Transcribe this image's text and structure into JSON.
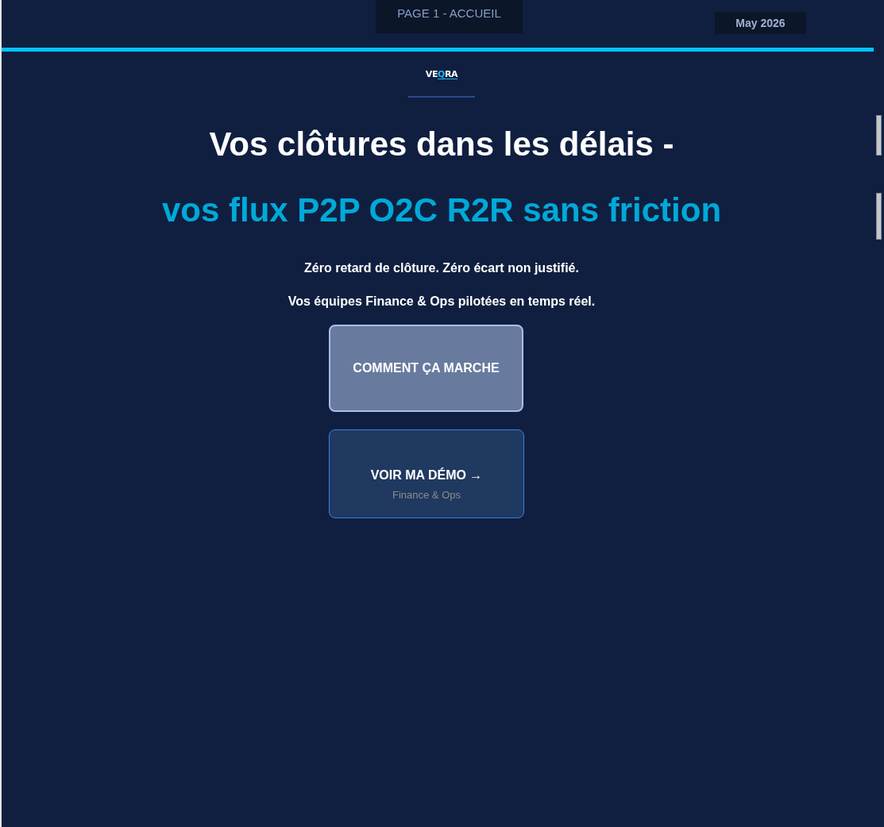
{
  "top_bar": {
    "page_label": "PAGE 1 - ACCUEIL",
    "date": "May 2026"
  },
  "logo": {
    "segments": [
      {
        "text": "VE",
        "accent": false,
        "underline": false
      },
      {
        "text": "Q",
        "accent": true,
        "underline": true
      },
      {
        "text": "RA",
        "accent": false,
        "underline": true
      }
    ]
  },
  "hero": {
    "title": "Vos clôtures dans les délais -",
    "subtitle": "vos flux P2P O2C R2R sans friction",
    "taglines": [
      "Zéro retard de clôture. Zéro écart non justifié.",
      "Vos équipes Finance & Ops pilotées en temps réel."
    ]
  },
  "buttons": [
    {
      "kind": "highlighted",
      "label": "COMMENT ÇA MARCHE"
    },
    {
      "kind": "primary",
      "label": "VOIR MA DÉMO →",
      "sublabel": "Finance & Ops"
    }
  ]
}
